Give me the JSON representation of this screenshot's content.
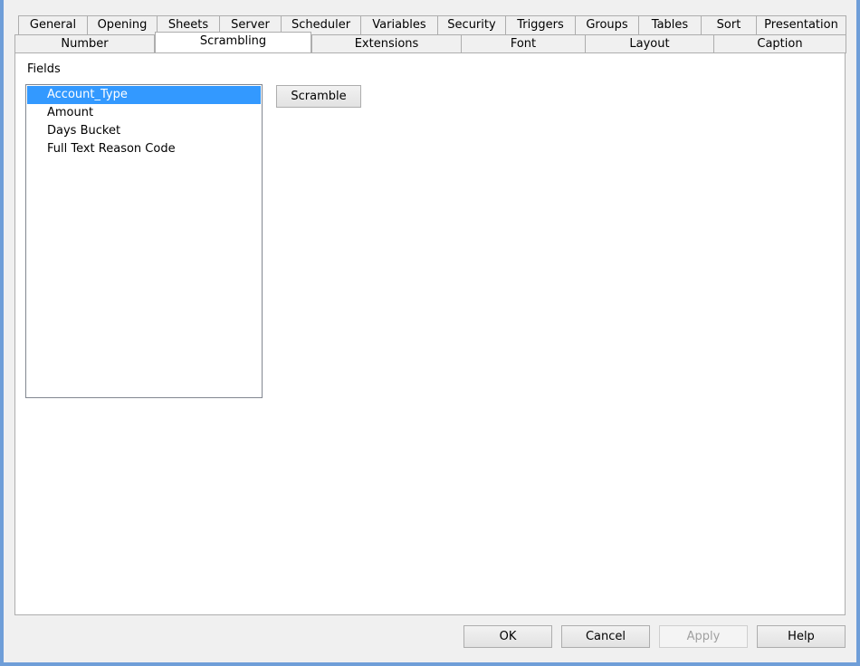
{
  "tabs_row1": [
    "General",
    "Opening",
    "Sheets",
    "Server",
    "Scheduler",
    "Variables",
    "Security",
    "Triggers",
    "Groups",
    "Tables",
    "Sort",
    "Presentation"
  ],
  "tabs_row2": [
    "Number",
    "Scrambling",
    "Extensions",
    "Font",
    "Layout",
    "Caption"
  ],
  "active_tab": "Scrambling",
  "fields": {
    "label": "Fields",
    "items": [
      "Account_Type",
      "Amount",
      "Days Bucket",
      "Full Text Reason Code"
    ],
    "selected": "Account_Type"
  },
  "scramble_button": "Scramble",
  "footer": {
    "ok": "OK",
    "cancel": "Cancel",
    "apply": "Apply",
    "help": "Help"
  },
  "colors": {
    "selection": "#3399ff",
    "window_border": "#6f9ed8"
  }
}
